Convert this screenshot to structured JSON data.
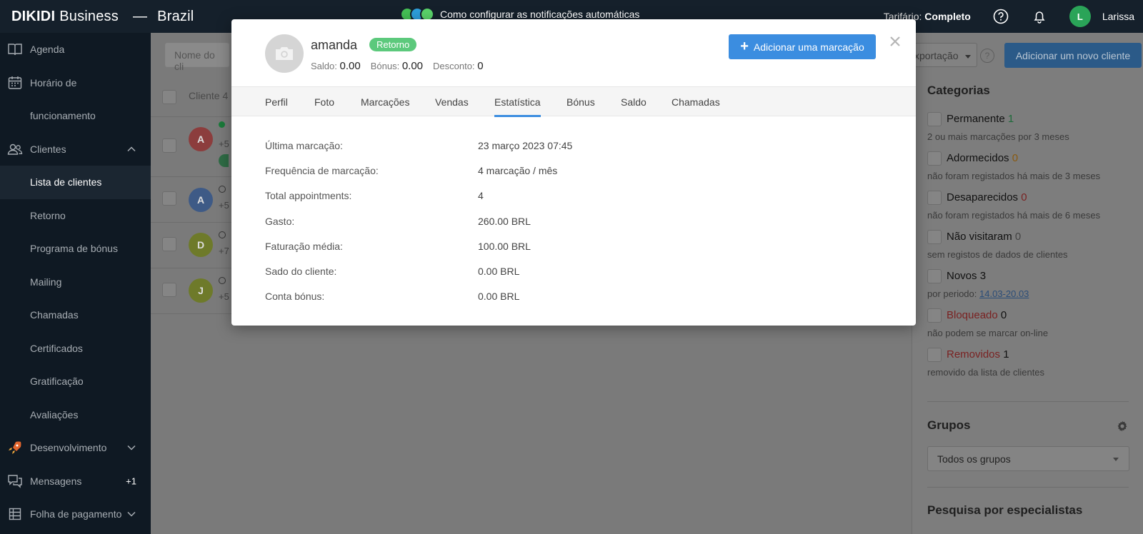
{
  "topbar": {
    "brand_main": "DIKIDI",
    "brand_sub": "Business",
    "dash": "—",
    "country": "Brazil",
    "announcement": "Como configurar as notificações automáticas",
    "tariff_label": "Tarifário:",
    "tariff_value": "Completo",
    "user_initial": "L",
    "user_name": "Larissa"
  },
  "sidebar": {
    "items": [
      {
        "label": "Agenda",
        "icon": "book-icon"
      },
      {
        "label": "Horário de",
        "icon": "calendar-icon"
      },
      {
        "label": "funcionamento"
      },
      {
        "label": "Clientes",
        "icon": "users-icon"
      },
      {
        "label": "Lista de clientes"
      },
      {
        "label": "Retorno"
      },
      {
        "label": "Programa de bónus"
      },
      {
        "label": "Mailing"
      },
      {
        "label": "Chamadas"
      },
      {
        "label": "Certificados"
      },
      {
        "label": "Gratificação"
      },
      {
        "label": "Avaliações"
      },
      {
        "label": "Desenvolvimento",
        "icon": "rocket-icon"
      },
      {
        "label": "Mensagens",
        "icon": "chat-icon",
        "badge": "+1"
      },
      {
        "label": "Folha de pagamento",
        "icon": "table-icon"
      }
    ]
  },
  "main": {
    "search_placeholder": "Nome do cli",
    "list_header": "Cliente 4",
    "rows": [
      {
        "initial": "A",
        "color": "#8c3d3d",
        "sub": "+5"
      },
      {
        "initial": "A",
        "color": "#3e5a86",
        "sub": "+5"
      },
      {
        "initial": "D",
        "color": "#6e7a2a",
        "sub": "+7"
      },
      {
        "initial": "J",
        "color": "#6e7a2a",
        "sub": "+5"
      }
    ],
    "export_label": "xportação",
    "help_label": "?",
    "add_client_label": "Adicionar um novo cliente"
  },
  "categories": {
    "title": "Categorias",
    "items": [
      {
        "name": "Permanente",
        "count": "1",
        "desc": "2 ou mais marcações por 3 meses"
      },
      {
        "name": "Adormecidos",
        "count": "0",
        "desc": "não foram registados há mais de 3 meses"
      },
      {
        "name": "Desaparecidos",
        "count": "0",
        "desc": "não foram registados há mais de 6 meses"
      },
      {
        "name": "Não visitaram",
        "count": "0",
        "desc": "sem registos de dados de clientes"
      },
      {
        "name": "Novos",
        "count": "3",
        "desc": "por periodo:",
        "link": "14.03-20.03"
      },
      {
        "name": "Bloqueado",
        "count": "0",
        "desc": "não podem se marcar on-line"
      },
      {
        "name": "Removidos",
        "count": "1",
        "desc": "removido da lista de clientes"
      }
    ],
    "groups_title": "Grupos",
    "groups_select": "Todos os grupos",
    "specialists_title": "Pesquisa por especialistas"
  },
  "modal": {
    "client_name": "amanda",
    "tag": "Retorno",
    "saldo_label": "Saldo:",
    "saldo_value": "0.00",
    "bonus_label": "Bónus:",
    "bonus_value": "0.00",
    "desconto_label": "Desconto:",
    "desconto_value": "0",
    "add_booking": "Adicionar uma marcação",
    "tabs": [
      "Perfil",
      "Foto",
      "Marcações",
      "Vendas",
      "Estatística",
      "Bónus",
      "Saldo",
      "Chamadas"
    ],
    "active_tab": "Estatística",
    "stats": [
      {
        "label": "Última marcação:",
        "value": "23 março 2023 07:45"
      },
      {
        "label": "Frequência de marcação:",
        "value": "4 marcação / mês"
      },
      {
        "label": "Total appointments:",
        "value": "4"
      },
      {
        "label": "Gasto:",
        "value": "260.00 BRL"
      },
      {
        "label": "Faturação média:",
        "value": "100.00 BRL"
      },
      {
        "label": "Sado do cliente:",
        "value": "0.00 BRL"
      },
      {
        "label": "Conta bónus:",
        "value": "0.00 BRL"
      }
    ]
  },
  "colors": {
    "topbar": "#15202b",
    "sidebar": "#0f1923",
    "primary": "#3b8de0",
    "tag_green": "#5cc97c"
  }
}
